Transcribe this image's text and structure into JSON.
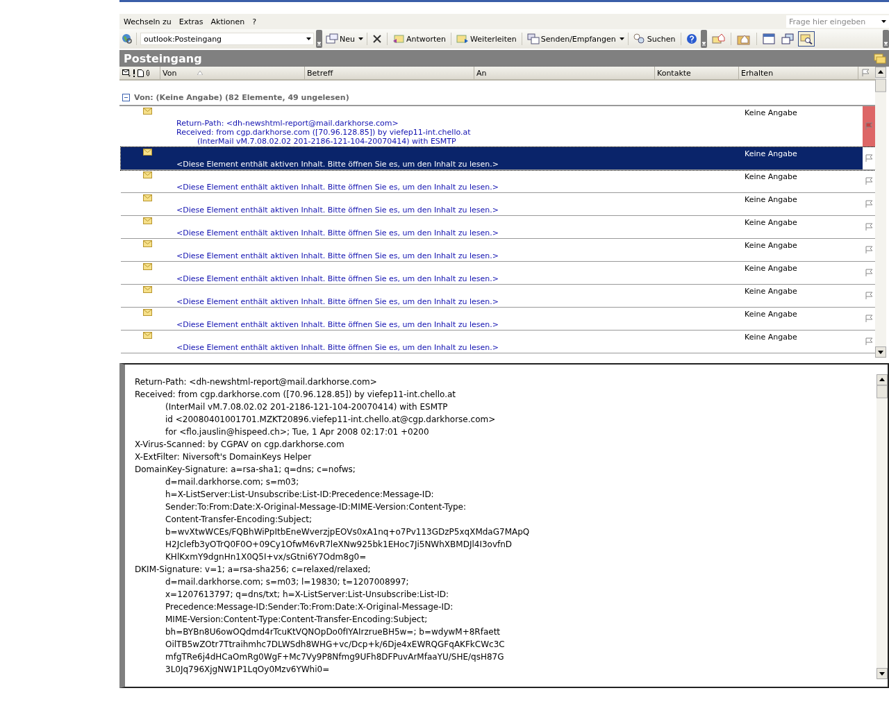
{
  "menu": [
    {
      "label": "Wechseln zu"
    },
    {
      "label": "Extras"
    },
    {
      "label": "Aktionen"
    },
    {
      "label": "?"
    }
  ],
  "ask_box": {
    "placeholder": "Frage hier eingeben"
  },
  "toolbar": {
    "address": "outlook:Posteingang",
    "buttons": [
      {
        "kind": "split",
        "label": "Neu"
      },
      {
        "kind": "icon"
      },
      {
        "kind": "button",
        "label": "Antworten"
      },
      {
        "kind": "button",
        "label": "Weiterleiten"
      },
      {
        "kind": "split",
        "label": "Senden/Empfangen"
      },
      {
        "kind": "button",
        "label": "Suchen"
      },
      {
        "kind": "icon"
      }
    ],
    "view_buttons": [
      {
        "selected": false
      },
      {
        "selected": false
      },
      {
        "selected": false
      },
      {
        "selected": false
      },
      {
        "selected": true
      }
    ]
  },
  "folder": {
    "title": "Posteingang"
  },
  "table": {
    "columns": [
      "Von",
      "Betreff",
      "An",
      "Kontakte",
      "Erhalten"
    ],
    "group": {
      "label": "Von: (Keine Angabe) (82 Elemente, 49 ungelesen)",
      "expanded": true
    },
    "rows": [
      {
        "received": "Keine Angabe",
        "selected": false,
        "flagged": true,
        "preview": [
          {
            "line": "Return-Path: <dh-newshtml-report@mail.darkhorse.com>"
          },
          {
            "line": "Received: from cgp.darkhorse.com ([70.96.128.85]) by viefep11-int.chello.at",
            "continuation": [
              "(InterMail vM.7.08.02.02 201-2186-121-104-20070414) with ESMTP"
            ]
          }
        ]
      },
      {
        "received": "Keine Angabe",
        "selected": true,
        "flagged": false,
        "preview": [
          {
            "line": "<Diese Element enthält aktiven Inhalt. Bitte öffnen Sie es, um den Inhalt zu lesen.>"
          }
        ]
      },
      {
        "received": "Keine Angabe",
        "selected": false,
        "flagged": false,
        "preview": [
          {
            "line": "<Diese Element enthält aktiven Inhalt. Bitte öffnen Sie es, um den Inhalt zu lesen.>"
          }
        ]
      },
      {
        "received": "Keine Angabe",
        "selected": false,
        "flagged": false,
        "preview": [
          {
            "line": "<Diese Element enthält aktiven Inhalt. Bitte öffnen Sie es, um den Inhalt zu lesen.>"
          }
        ]
      },
      {
        "received": "Keine Angabe",
        "selected": false,
        "flagged": false,
        "preview": [
          {
            "line": "<Diese Element enthält aktiven Inhalt. Bitte öffnen Sie es, um den Inhalt zu lesen.>"
          }
        ]
      },
      {
        "received": "Keine Angabe",
        "selected": false,
        "flagged": false,
        "preview": [
          {
            "line": "<Diese Element enthält aktiven Inhalt. Bitte öffnen Sie es, um den Inhalt zu lesen.>"
          }
        ]
      },
      {
        "received": "Keine Angabe",
        "selected": false,
        "flagged": false,
        "preview": [
          {
            "line": "<Diese Element enthält aktiven Inhalt. Bitte öffnen Sie es, um den Inhalt zu lesen.>"
          }
        ]
      },
      {
        "received": "Keine Angabe",
        "selected": false,
        "flagged": false,
        "preview": [
          {
            "line": "<Diese Element enthält aktiven Inhalt. Bitte öffnen Sie es, um den Inhalt zu lesen.>"
          }
        ]
      },
      {
        "received": "Keine Angabe",
        "selected": false,
        "flagged": false,
        "preview": [
          {
            "line": "<Diese Element enthält aktiven Inhalt. Bitte öffnen Sie es, um den Inhalt zu lesen.>"
          }
        ]
      },
      {
        "received": "Keine Angabe",
        "selected": false,
        "flagged": false,
        "preview": [
          {
            "line": "<Diese Element enthält aktiven Inhalt. Bitte öffnen Sie es, um den Inhalt zu lesen.>"
          }
        ]
      }
    ]
  },
  "reading_pane": {
    "headers": [
      {
        "line": "Return-Path: <dh-newshtml-report@mail.darkhorse.com>"
      },
      {
        "line": "Received: from cgp.darkhorse.com ([70.96.128.85]) by viefep11-int.chello.at",
        "continuation": [
          "(InterMail vM.7.08.02.02 201-2186-121-104-20070414) with ESMTP",
          "id <20080401001701.MZKT20896.viefep11-int.chello.at@cgp.darkhorse.com>",
          "for <flo.jauslin@hispeed.ch>; Tue, 1 Apr 2008 02:17:01 +0200"
        ]
      },
      {
        "line": "X-Virus-Scanned: by CGPAV on cgp.darkhorse.com"
      },
      {
        "line": "X-ExtFilter: Niversoft's DomainKeys Helper"
      },
      {
        "line": "DomainKey-Signature: a=rsa-sha1; q=dns; c=nofws;",
        "continuation": [
          "d=mail.darkhorse.com; s=m03;",
          "h=X-ListServer:List-Unsubscribe:List-ID:Precedence:Message-ID:",
          "Sender:To:From:Date:X-Original-Message-ID:MIME-Version:Content-Type:",
          "Content-Transfer-Encoding:Subject;",
          "b=wvXtwWCEs/FQBhWiPpItbEneWverzjpEOVs0xA1nq+o7Pv113GDzP5xqXMdaG7MApQ",
          "H2Jclefb3yOTrQ0F0O+09Cy1OfwM6vR7leXNw925bk1EHoc7Ji5NWhXBMDJl4I3ovfnD",
          "KHlKxmY9dgnHn1X0Q5I+vx/sGtni6Y7Odm8g0="
        ]
      },
      {
        "line": "DKIM-Signature: v=1; a=rsa-sha256; c=relaxed/relaxed;",
        "continuation": [
          "d=mail.darkhorse.com; s=m03; l=19830; t=1207008997;",
          "x=1207613797; q=dns/txt; h=X-ListServer:List-Unsubscribe:List-ID:",
          "Precedence:Message-ID:Sender:To:From:Date:X-Original-Message-ID:",
          "MIME-Version:Content-Type:Content-Transfer-Encoding:Subject;",
          "bh=BYBn8U6owOQdmd4rTcuKtVQNOpDo0fIYAIrzrueBH5w=; b=wdywM+8Rfaett",
          "OilTB5wZOtr7Ttraihmhc7DLWSdh8WHG+vc/Dcp+k/6Dje4xEWRQGFqAKFkCWc3C",
          "mfgTRe6j4dHCaOmRg0WgF+Mc7Vy9P8Nfmg9UFh8DFPuvArMfaaYU/SHE/qsH87G",
          "3L0Jq796XjgNW1P1LqOy0Mzv6YWhi0="
        ]
      }
    ]
  }
}
